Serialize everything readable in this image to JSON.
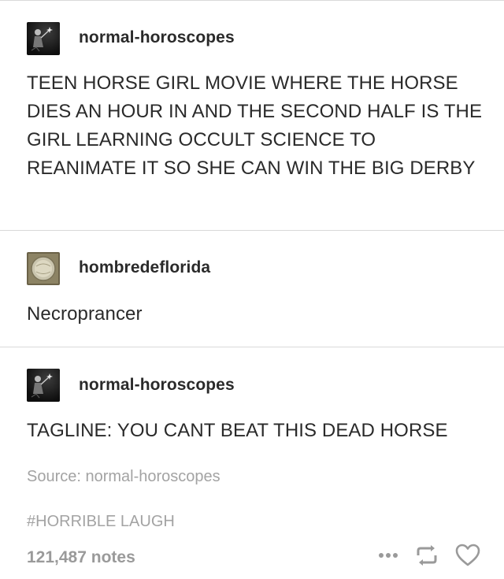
{
  "posts": [
    {
      "username": "normal-horoscopes",
      "text": "TEEN HORSE GIRL MOVIE WHERE THE HORSE DIES AN HOUR IN AND THE SECOND HALF IS THE GIRL LEARNING OCCULT SCIENCE TO REANIMATE IT SO SHE CAN WIN THE BIG DERBY"
    },
    {
      "username": "hombredeflorida",
      "text": "Necroprancer"
    },
    {
      "username": "normal-horoscopes",
      "text": "TAGLINE: YOU CANT BEAT THIS DEAD HORSE"
    }
  ],
  "footer": {
    "source": "Source: normal-horoscopes",
    "tag": "#HORRIBLE LAUGH",
    "notes": "121,487 notes"
  },
  "icons": {
    "more": "more-dots-icon",
    "reblog": "reblog-icon",
    "like": "heart-icon"
  },
  "colors": {
    "text": "#2a2a2a",
    "muted": "#a3a3a3",
    "divider": "#d9d9d9"
  }
}
